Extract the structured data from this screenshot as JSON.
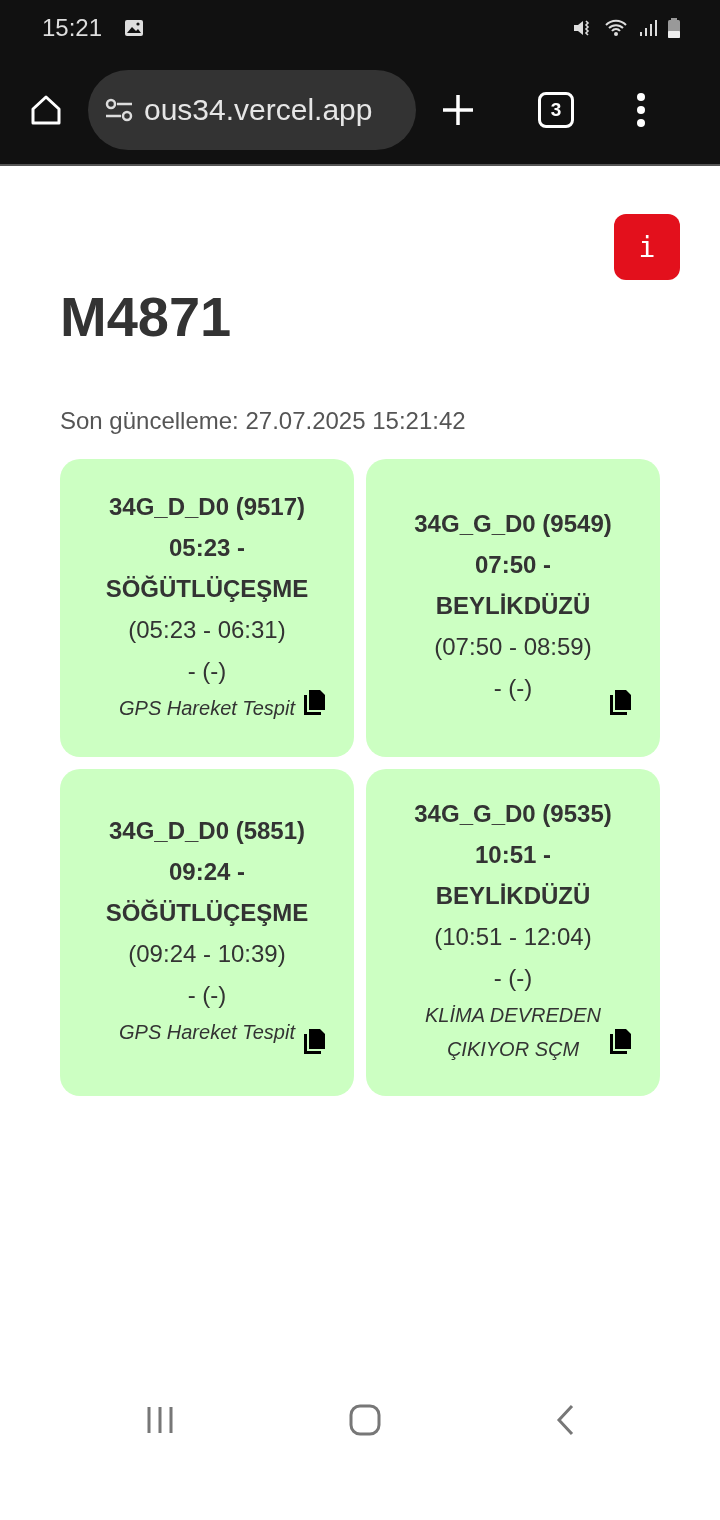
{
  "status_bar": {
    "time": "15:21"
  },
  "browser": {
    "url": "ous34.vercel.app",
    "tab_count": "3"
  },
  "info_button": {
    "label": "i"
  },
  "title": "M4871",
  "last_update": "Son güncelleme: 27.07.2025 15:21:42",
  "cards": [
    {
      "title_lines": [
        "34G_D_D0 (9517)",
        "05:23 -",
        "SÖĞÜTLÜÇEŞME"
      ],
      "time_range": "(05:23 - 06:31)",
      "detail": "- (-)",
      "note": [
        "GPS Hareket Tespit"
      ]
    },
    {
      "title_lines": [
        "34G_G_D0 (9549)",
        "07:50 -",
        "BEYLİKDÜZÜ"
      ],
      "time_range": "(07:50 - 08:59)",
      "detail": "- (-)"
    },
    {
      "title_lines": [
        "34G_D_D0 (5851)",
        "09:24 -",
        "SÖĞÜTLÜÇEŞME"
      ],
      "time_range": "(09:24 - 10:39)",
      "detail": "- (-)",
      "note": [
        "GPS Hareket Tespit"
      ]
    },
    {
      "title_lines": [
        "34G_G_D0 (9535)",
        "10:51 -",
        "BEYLİKDÜZÜ"
      ],
      "time_range": "(10:51 - 12:04)",
      "detail": "- (-)",
      "note": [
        "KLİMA DEVREDEN",
        "ÇIKIYOR SÇM"
      ]
    }
  ]
}
